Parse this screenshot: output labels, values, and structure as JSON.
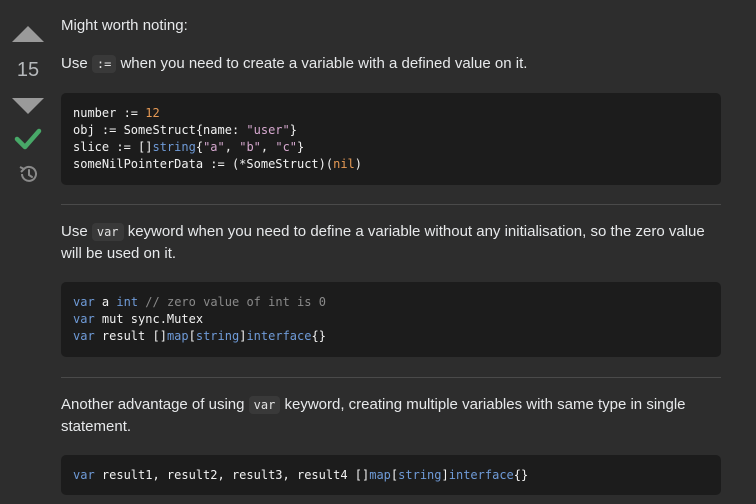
{
  "vote": {
    "count": "15"
  },
  "answer": {
    "intro": "Might worth noting:",
    "para1": {
      "before": "Use ",
      "code": ":=",
      "after": " when you need to create a variable with a defined value on it."
    },
    "code1": [
      [
        "number := ",
        "12"
      ],
      [
        "obj := SomeStruct{name: ",
        "\"user\"",
        "}"
      ],
      [
        "slice := []",
        "string",
        "{",
        "\"a\"",
        ", ",
        "\"b\"",
        ", ",
        "\"c\"",
        "}"
      ],
      [
        "someNilPointerData := (*SomeStruct)(",
        "nil",
        ")"
      ]
    ],
    "para2": {
      "before": "Use ",
      "code": "var",
      "after": " keyword when you need to define a variable without any initialisation, so the zero value will be used on it."
    },
    "code2": [
      [
        "var",
        " a ",
        "int",
        " ",
        "// zero value of int is 0"
      ],
      [
        "var",
        " mut sync.Mutex"
      ],
      [
        "var",
        " result []",
        "map",
        "[",
        "string",
        "]",
        "interface",
        "{}"
      ]
    ],
    "para3": {
      "before": "Another advantage of using ",
      "code": "var",
      "after": " keyword, creating multiple variables with same type in single statement."
    },
    "code3": [
      [
        "var",
        " result1, result2, result3, result4 []",
        "map",
        "[",
        "string",
        "]",
        "interface",
        "{}"
      ]
    ]
  },
  "colors": {
    "background": "#2d2d2d",
    "code_bg": "#1c1c1c",
    "accepted": "#48a868",
    "keyword": "#6f9bd8",
    "string": "#d6a8cf",
    "number": "#e69a55"
  },
  "icons": [
    "vote-up-arrow",
    "vote-down-arrow",
    "accepted-check",
    "history"
  ]
}
